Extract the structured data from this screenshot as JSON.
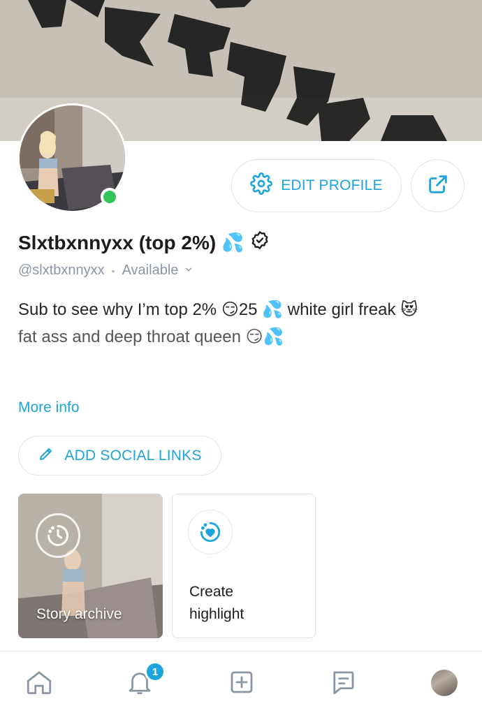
{
  "profile": {
    "name": "Slxtbxnnyxx (top 2%)",
    "name_emoji": "💦",
    "handle": "@slxtbxnnyxx",
    "separator": "•",
    "status": "Available",
    "bio_line1": "Sub to see why I’m top 2% 😏25 💦 white girl freak 😻",
    "bio_line2": "fat ass and deep throat queen 😏💦",
    "more_info": "More info"
  },
  "actions": {
    "edit_profile": "EDIT PROFILE",
    "add_social_links": "ADD SOCIAL LINKS"
  },
  "stories": {
    "archive_label": "Story archive",
    "create_label_line1": "Create",
    "create_label_line2": "highlight"
  },
  "nav": {
    "notifications_badge": "1",
    "items": [
      "home-icon",
      "bell-icon",
      "plus-square-icon",
      "message-icon",
      "profile-avatar"
    ]
  },
  "colors": {
    "accent": "#1da4dc",
    "online": "#35c45a",
    "muted": "#8a96a3"
  }
}
